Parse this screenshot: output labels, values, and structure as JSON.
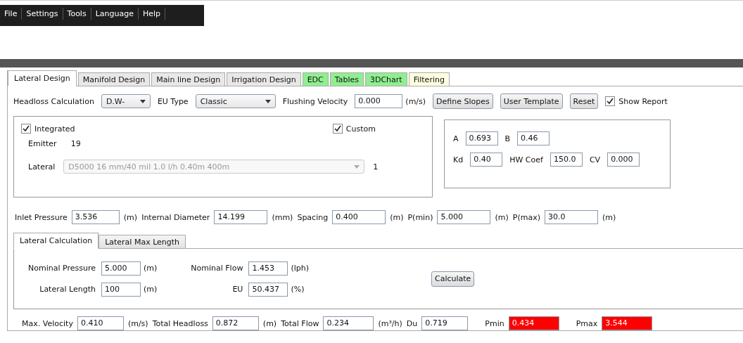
{
  "menu": [
    "File",
    "Settings",
    "Tools",
    "Language",
    "Help"
  ],
  "tabs": [
    {
      "label": "Lateral Design",
      "selected": true,
      "color": "#ffffff"
    },
    {
      "label": "Manifold Design",
      "selected": false,
      "color": "#e8e8e8"
    },
    {
      "label": "Main line Design",
      "selected": false,
      "color": "#e8e8e8"
    },
    {
      "label": "Irrigation Design",
      "selected": false,
      "color": "#e8e8e8"
    },
    {
      "label": "EDC",
      "selected": false,
      "color": "#90ee90"
    },
    {
      "label": "Tables",
      "selected": false,
      "color": "#90ee90"
    },
    {
      "label": "3DChart",
      "selected": false,
      "color": "#90ee90"
    },
    {
      "label": "Filtering",
      "selected": false,
      "color": "#ffffe0"
    }
  ],
  "toolbar": {
    "headloss": {
      "label": "Headloss Calculation",
      "value": "D.W-"
    },
    "eu_type": {
      "label": "EU Type",
      "value": "Classic"
    },
    "flushing": {
      "label": "Flushing Velocity",
      "value": "0.000",
      "unit": "(m/s)"
    },
    "buttons": [
      "Define Slopes",
      "User Template",
      "Reset"
    ],
    "show_report": {
      "label": "Show Report",
      "checked": true
    }
  },
  "emitter_panel": {
    "integrated": {
      "label": "Integrated",
      "checked": true
    },
    "custom": {
      "label": "Custom",
      "checked": true
    },
    "emitter": {
      "label": "Emitter",
      "value": "19"
    },
    "lateral": {
      "label": "Lateral",
      "value": "D5000 16 mm/40 mil 1.0 l/h 0.40m 400m",
      "disabled": true,
      "count": "1"
    }
  },
  "coefficients": [
    [
      {
        "label": "A",
        "value": "0.693"
      },
      {
        "label": "B",
        "value": "0.46"
      }
    ],
    [
      {
        "label": "Kd",
        "value": "0.40"
      },
      {
        "label": "HW Coef",
        "value": "150.0"
      },
      {
        "label": "CV",
        "value": "0.000"
      }
    ]
  ],
  "params": [
    {
      "label": "Inlet Pressure",
      "value": "3.536",
      "unit": "(m)"
    },
    {
      "label": "Internal Diameter",
      "value": "14.199",
      "unit": "(mm)"
    },
    {
      "label": "Spacing",
      "value": "0.400",
      "unit": "(m)"
    },
    {
      "label": "P(min)",
      "value": "5.000",
      "unit": "(m)"
    },
    {
      "label": "P(max)",
      "value": "30.0",
      "unit": "(m)"
    }
  ],
  "sub_tabs": [
    {
      "label": "Lateral Calculation",
      "selected": true
    },
    {
      "label": "Lateral Max Length",
      "selected": false
    }
  ],
  "calculation": {
    "fields": [
      {
        "label": "Nominal Pressure",
        "value": "5.000",
        "unit": "(m)"
      },
      {
        "label": "Nominal Flow",
        "value": "1.453",
        "unit": "(lph)"
      },
      {
        "label": "Lateral Length",
        "value": "100",
        "unit": "(m)"
      },
      {
        "label": "EU",
        "value": "50.437",
        "unit": "(%)"
      }
    ],
    "button": "Calculate"
  },
  "results": [
    {
      "label": "Max. Velocity",
      "value": "0.410",
      "unit": "(m/s)",
      "alert": false
    },
    {
      "label": "Total Headloss",
      "value": "0.872",
      "unit": "(m)",
      "alert": false
    },
    {
      "label": "Total Flow",
      "value": "0.234",
      "unit": "(m³/h)",
      "alert": false
    },
    {
      "label": "Du",
      "value": "0.719",
      "alert": false
    },
    {
      "label": "Pmin",
      "value": "0.434",
      "alert": true
    },
    {
      "label": "Pmax",
      "value": "3.544",
      "alert": true
    }
  ]
}
